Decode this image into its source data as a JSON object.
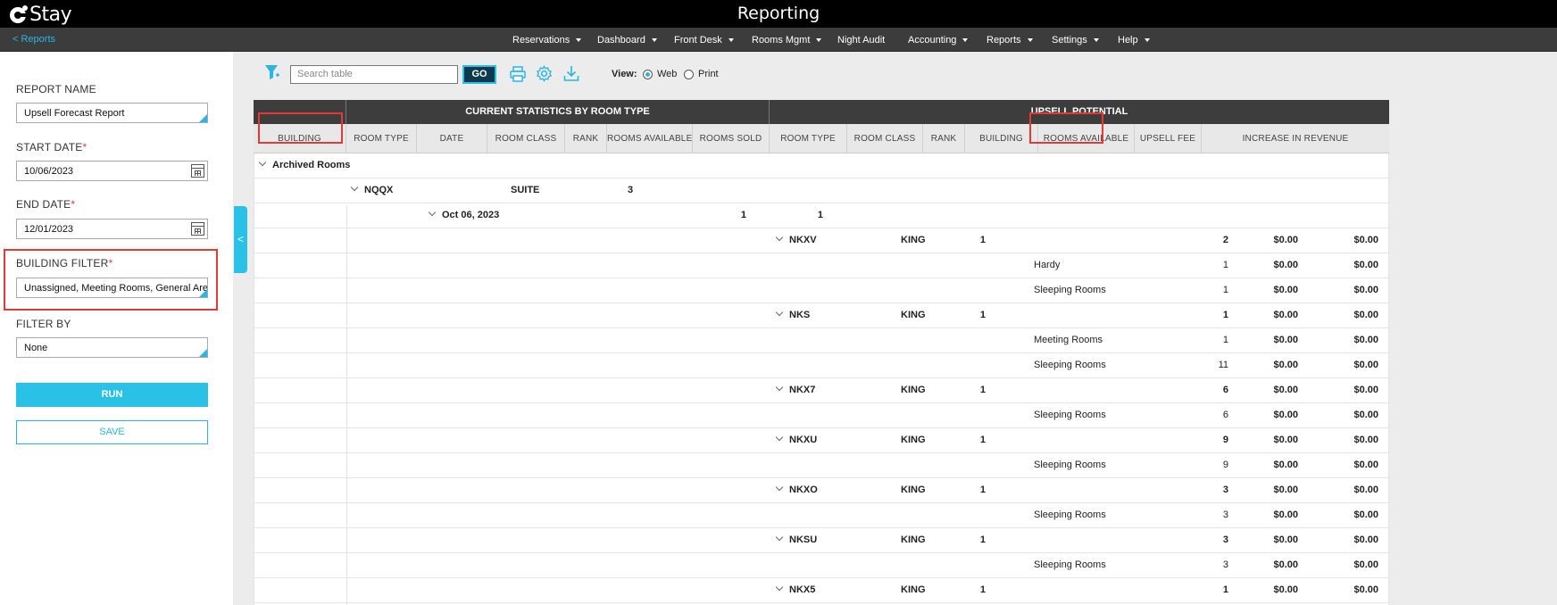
{
  "app": {
    "logo_text": "Stay",
    "title": "Reporting",
    "back_link": "< Reports"
  },
  "menu": [
    {
      "label": "Reservations",
      "caret": true
    },
    {
      "label": "Dashboard",
      "caret": true
    },
    {
      "label": "Front Desk",
      "caret": true
    },
    {
      "label": "Rooms Mgmt",
      "caret": true
    },
    {
      "label": "Night Audit",
      "caret": false
    },
    {
      "label": "Accounting",
      "caret": true
    },
    {
      "label": "Reports",
      "caret": true
    },
    {
      "label": "Settings",
      "caret": true
    },
    {
      "label": "Help",
      "caret": true
    }
  ],
  "sidebar": {
    "report_name_label": "REPORT NAME",
    "report_name_value": "Upsell Forecast Report",
    "start_date_label": "START DATE",
    "start_date_value": "10/06/2023",
    "end_date_label": "END DATE",
    "end_date_value": "12/01/2023",
    "building_filter_label": "BUILDING FILTER",
    "building_filter_value": "Unassigned, Meeting Rooms, General Are...",
    "filter_by_label": "FILTER BY",
    "filter_by_value": "None",
    "required_mark": "*",
    "run_label": "RUN",
    "save_label": "SAVE",
    "collapse_glyph": "<"
  },
  "toolbar": {
    "search_placeholder": "Search table",
    "go_label": "GO",
    "view_label": "View:",
    "view_web": "Web",
    "view_print": "Print",
    "selected_view": "Web"
  },
  "table": {
    "group_current": "CURRENT STATISTICS BY ROOM TYPE",
    "group_upsell": "UPSELL POTENTIAL",
    "columns": [
      "BUILDING",
      "ROOM TYPE",
      "DATE",
      "ROOM CLASS",
      "RANK",
      "ROOMS AVAILABLE",
      "ROOMS SOLD",
      "ROOM TYPE",
      "ROOM CLASS",
      "RANK",
      "BUILDING",
      "ROOMS AVAILABLE",
      "UPSELL FEE",
      "INCREASE IN REVENUE"
    ],
    "archived_label": "Archived Rooms",
    "room_type_row": {
      "room_type": "NQQX",
      "room_class": "SUITE",
      "rank": "3"
    },
    "date_row": {
      "date": "Oct 06, 2023",
      "rooms_available": "1",
      "rooms_sold": "1"
    },
    "rows": [
      {
        "kind": "type",
        "room_type": "NKXV",
        "room_class": "KING",
        "rank": "1",
        "available": "2",
        "fee": "$0.00",
        "revenue": "$0.00"
      },
      {
        "kind": "bldg",
        "building": "Hardy",
        "available": "1",
        "fee": "$0.00",
        "revenue": "$0.00"
      },
      {
        "kind": "bldg",
        "building": "Sleeping Rooms",
        "available": "1",
        "fee": "$0.00",
        "revenue": "$0.00"
      },
      {
        "kind": "type",
        "room_type": "NKS",
        "room_class": "KING",
        "rank": "1",
        "available": "1",
        "fee": "$0.00",
        "revenue": "$0.00"
      },
      {
        "kind": "bldg",
        "building": "Meeting Rooms",
        "available": "1",
        "fee": "$0.00",
        "revenue": "$0.00"
      },
      {
        "kind": "bldg",
        "building": "Sleeping Rooms",
        "available": "11",
        "fee": "$0.00",
        "revenue": "$0.00"
      },
      {
        "kind": "type",
        "room_type": "NKX7",
        "room_class": "KING",
        "rank": "1",
        "available": "6",
        "fee": "$0.00",
        "revenue": "$0.00"
      },
      {
        "kind": "bldg",
        "building": "Sleeping Rooms",
        "available": "6",
        "fee": "$0.00",
        "revenue": "$0.00"
      },
      {
        "kind": "type",
        "room_type": "NKXU",
        "room_class": "KING",
        "rank": "1",
        "available": "9",
        "fee": "$0.00",
        "revenue": "$0.00"
      },
      {
        "kind": "bldg",
        "building": "Sleeping Rooms",
        "available": "9",
        "fee": "$0.00",
        "revenue": "$0.00"
      },
      {
        "kind": "type",
        "room_type": "NKXO",
        "room_class": "KING",
        "rank": "1",
        "available": "3",
        "fee": "$0.00",
        "revenue": "$0.00"
      },
      {
        "kind": "bldg",
        "building": "Sleeping Rooms",
        "available": "3",
        "fee": "$0.00",
        "revenue": "$0.00"
      },
      {
        "kind": "type",
        "room_type": "NKSU",
        "room_class": "KING",
        "rank": "1",
        "available": "3",
        "fee": "$0.00",
        "revenue": "$0.00"
      },
      {
        "kind": "bldg",
        "building": "Sleeping Rooms",
        "available": "3",
        "fee": "$0.00",
        "revenue": "$0.00"
      },
      {
        "kind": "type",
        "room_type": "NKX5",
        "room_class": "KING",
        "rank": "1",
        "available": "1",
        "fee": "$0.00",
        "revenue": "$0.00"
      }
    ]
  },
  "colors": {
    "accent": "#29c1e6",
    "highlight": "#e53935",
    "header_dark": "#3d3d3d",
    "topbar": "#000000"
  },
  "icons": [
    "filter-icon",
    "print-icon",
    "gear-icon",
    "download-icon",
    "calendar-icon",
    "chevron-down-icon",
    "logo-icon"
  ]
}
